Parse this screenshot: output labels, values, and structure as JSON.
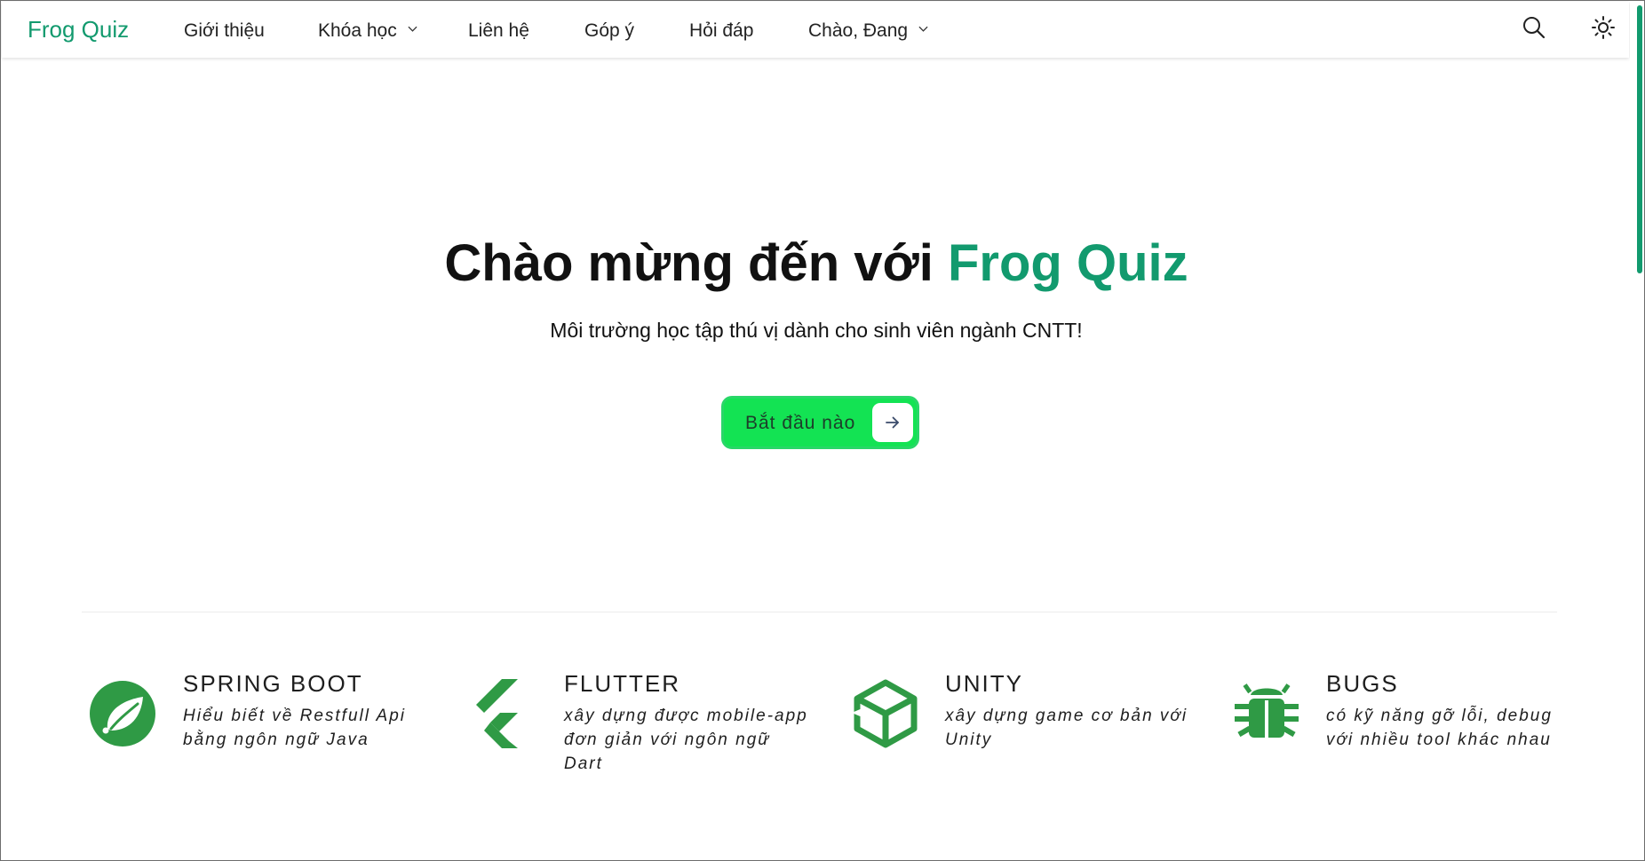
{
  "brand": "Frog Quiz",
  "nav": {
    "items": [
      {
        "label": "Giới thiệu",
        "dropdown": false
      },
      {
        "label": "Khóa học",
        "dropdown": true
      },
      {
        "label": "Liên hệ",
        "dropdown": false
      },
      {
        "label": "Góp ý",
        "dropdown": false
      },
      {
        "label": "Hỏi đáp",
        "dropdown": false
      },
      {
        "label": "Chào, Đang",
        "dropdown": true
      }
    ],
    "icons": [
      "search-icon",
      "sun-icon"
    ]
  },
  "hero": {
    "title_prefix": "Chào mừng đến với ",
    "title_accent": "Frog Quiz",
    "subtitle": "Môi trường học tập thú vị dành cho sinh viên ngành CNTT!",
    "cta_label": "Bắt đầu nào"
  },
  "features": [
    {
      "icon": "spring-leaf-icon",
      "title": "SPRING BOOT",
      "description": "Hiểu biết về Restfull Api bằng ngôn ngữ Java"
    },
    {
      "icon": "flutter-icon",
      "title": "FLUTTER",
      "description": "xây dựng được mobile-app đơn giản với ngôn ngữ Dart"
    },
    {
      "icon": "unity-icon",
      "title": "UNITY",
      "description": "xây dựng game cơ bản với Unity"
    },
    {
      "icon": "bug-icon",
      "title": "BUGS",
      "description": "có kỹ năng gỡ lỗi, debug với nhiều tool khác nhau"
    }
  ],
  "colors": {
    "brand": "#129a6e",
    "cta": "#13e353",
    "icon_green": "#2f9a45"
  }
}
